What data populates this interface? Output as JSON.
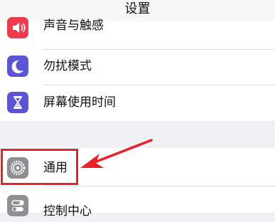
{
  "header": {
    "title": "设置"
  },
  "group1": {
    "items": [
      {
        "label": "声音与触感",
        "icon": "speaker-icon",
        "color": "#ee3b4d"
      },
      {
        "label": "勿扰模式",
        "icon": "moon-icon",
        "color": "#5b55d6"
      },
      {
        "label": "屏幕使用时间",
        "icon": "hourglass-icon",
        "color": "#5b55d6"
      }
    ]
  },
  "group2": {
    "items": [
      {
        "label": "通用",
        "icon": "gear-icon",
        "color": "#8e8e93"
      },
      {
        "label": "控制中心",
        "icon": "toggles-icon",
        "color": "#8e8e93"
      }
    ]
  },
  "annotation": {
    "color": "#e8202a"
  }
}
